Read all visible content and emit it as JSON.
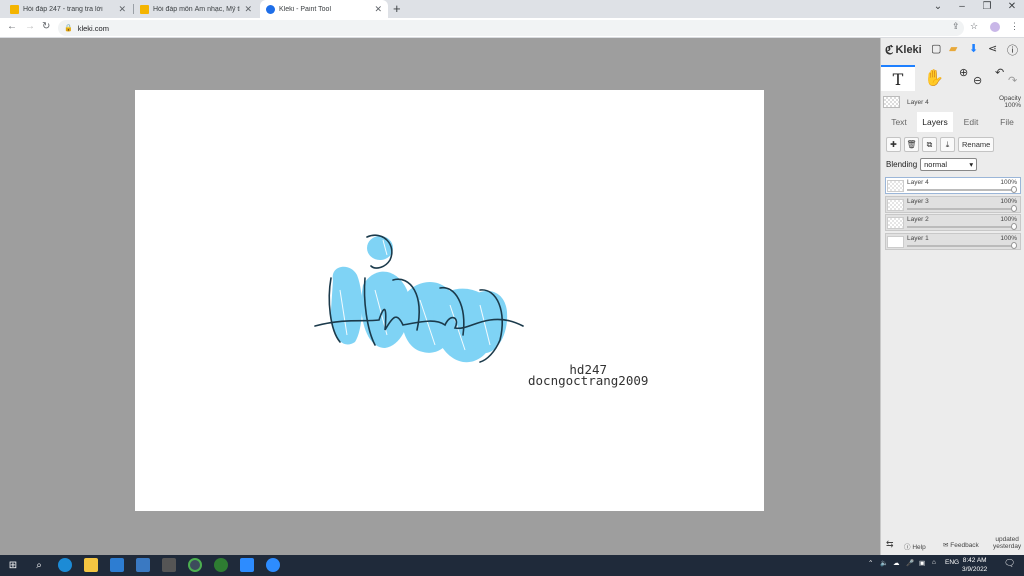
{
  "browser": {
    "tabs": [
      {
        "title": "Hỏi đáp 247 - trang tra lời",
        "active": false
      },
      {
        "title": "Hỏi đáp môn Âm nhạc, Mỹ thuật",
        "active": false
      },
      {
        "title": "Kleki - Paint Tool",
        "active": true
      }
    ],
    "new_tab": "+",
    "url": "kleki.com"
  },
  "canvas": {
    "signature_line1": "hd247",
    "signature_line2": "docngoctrang2009",
    "drawing_colors": {
      "fill": "#7fd3f5",
      "stroke": "#1b3a4b"
    }
  },
  "panel": {
    "logo": "Kleki",
    "current_layer_name": "Layer 4",
    "opacity_label": "Opacity",
    "opacity_value": "100%",
    "tabs": [
      "Text",
      "Layers",
      "Edit",
      "File"
    ],
    "rename_label": "Rename",
    "blending_label": "Blending",
    "blending_value": "normal",
    "layers": [
      {
        "name": "Layer 4",
        "opacity": "100%"
      },
      {
        "name": "Layer 3",
        "opacity": "100%"
      },
      {
        "name": "Layer 2",
        "opacity": "100%"
      },
      {
        "name": "Layer 1",
        "opacity": "100%"
      }
    ],
    "help_label": "Help",
    "feedback_label": "Feedback",
    "updated_line1": "updated",
    "updated_line2": "yesterday"
  },
  "taskbar": {
    "lang": "ENG",
    "time": "8:42 AM",
    "date": "3/9/2022"
  }
}
